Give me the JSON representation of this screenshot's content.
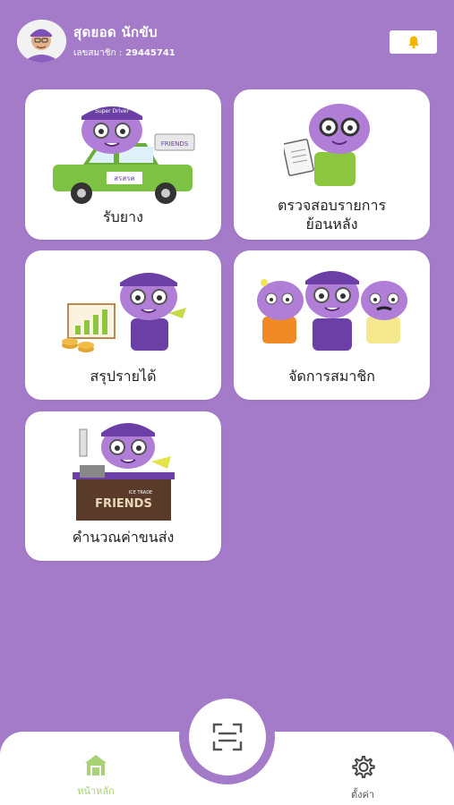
{
  "header": {
    "user_name": "สุดยอด นักขับ",
    "member_label": "เลขสมาชิก :",
    "member_id": "29445741"
  },
  "cards": [
    {
      "label_lines": [
        "รับยาง"
      ]
    },
    {
      "label_lines": [
        "ตรวจสอบรายการ",
        "ย้อนหลัง"
      ]
    },
    {
      "label_lines": [
        "สรุปรายได้"
      ]
    },
    {
      "label_lines": [
        "จัดการสมาชิก"
      ]
    },
    {
      "label_lines": [
        "คำนวณค่าขนส่ง"
      ]
    }
  ],
  "card_art_text": {
    "truck_sign": "สรสรค",
    "shop_sign": "FRIENDS",
    "shop_small": "ICE TRADE",
    "cap_text": "Super Driver"
  },
  "bottom_nav": {
    "home_label": "หน้าหลัก",
    "settings_label": "ตั้งค่า"
  },
  "colors": {
    "background": "#a47bc8",
    "active_nav": "#a8d275",
    "bell": "#f4b400"
  },
  "icons": {
    "bell": "bell-icon",
    "home": "home-icon",
    "settings": "gear-icon",
    "scan": "scan-icon"
  }
}
